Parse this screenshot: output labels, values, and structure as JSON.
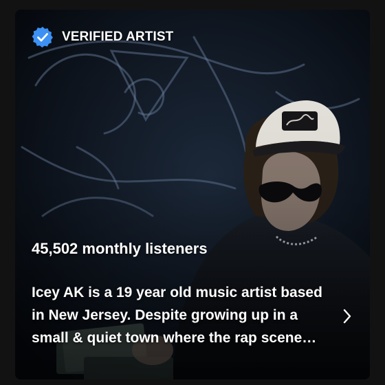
{
  "card": {
    "badge": {
      "icon": "verified-badge-icon",
      "label": "VERIFIED ARTIST",
      "color": "#3d91f4"
    },
    "monthly_listeners": "45,502 monthly listeners",
    "bio": "Icey AK is a 19 year old music artist based in New Jersey. Despite growing up in a small & quiet town where the rap scene isn't very big, he has managed to make a name for himself.",
    "more_icon": "chevron-right-icon"
  }
}
